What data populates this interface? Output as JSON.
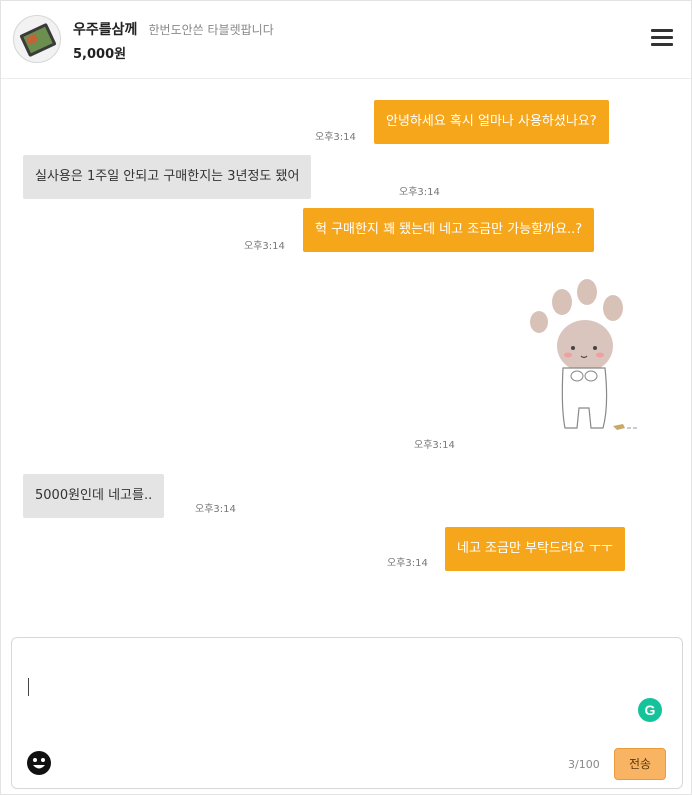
{
  "header": {
    "seller_name": "우주를삼께",
    "subtitle": "한번도안쓴 타블렛팝니다",
    "price": "5,000원",
    "menu_icon": "hamburger-menu-icon"
  },
  "messages": [
    {
      "side": "me",
      "text": "안녕하세요 혹시 얼마나 사용하셨나요?",
      "time": "오후3:14"
    },
    {
      "side": "them",
      "text": "실사용은 1주일 안되고 구매한지는 3년정도 됐어",
      "time": "오후3:14"
    },
    {
      "side": "me",
      "text": "헉 구매한지 꽤 됐는데 네고 조금만 가능할까요..?",
      "time": "오후3:14"
    },
    {
      "side": "me",
      "type": "sticker",
      "icon": "bear-paw-sticker",
      "time": "오후3:14"
    },
    {
      "side": "them",
      "text": "5000원인데 네고를..",
      "time": "오후3:14"
    },
    {
      "side": "me",
      "text": "네고 조금만 부탁드려요 ㅜㅜ",
      "time": "오후3:14"
    }
  ],
  "composer": {
    "value": "",
    "counter": "3/100",
    "send_label": "전송",
    "emoji_icon": "emoji-icon",
    "grammar_icon": "grammarly-icon",
    "grammar_letter": "G"
  },
  "colors": {
    "my_bubble": "#f6a61a",
    "their_bubble": "#e4e4e4",
    "send_button": "#f9b463",
    "grammar_icon": "#15c39a"
  }
}
